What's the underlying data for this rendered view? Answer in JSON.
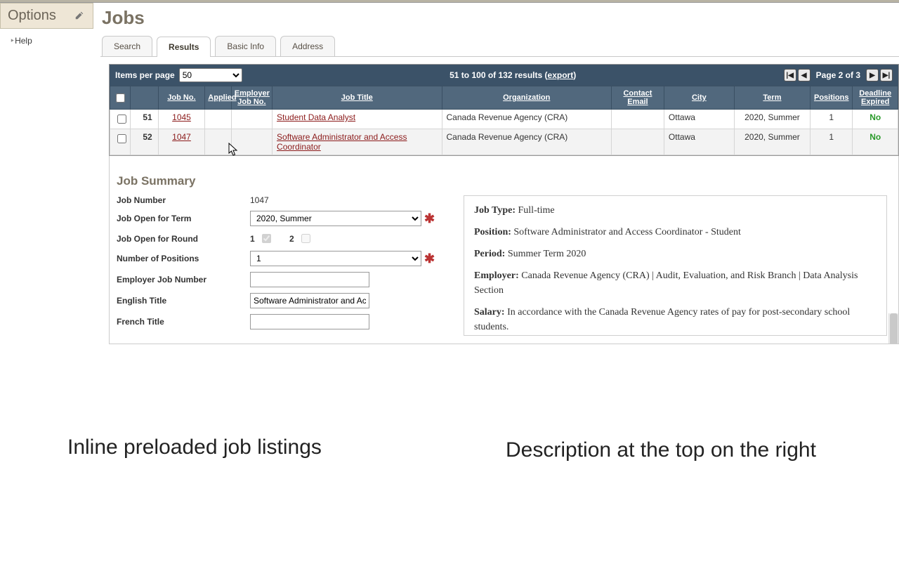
{
  "sidebar": {
    "title": "Options",
    "help": "Help"
  },
  "page": {
    "title": "Jobs"
  },
  "tabs": [
    "Search",
    "Results",
    "Basic Info",
    "Address"
  ],
  "activeTab": 1,
  "toolbar": {
    "itemsPerPageLabel": "Items per page",
    "itemsPerPageValue": "50",
    "resultsText": "51 to 100 of 132 results (",
    "exportLabel": "export",
    "resultsTextEnd": ")",
    "pageLabel": "Page 2 of 3",
    "first": "|◀",
    "prev": "◀",
    "next": "▶",
    "last": "▶|"
  },
  "columns": [
    "",
    "",
    "Job No.",
    "Applied",
    "Employer Job No.",
    "Job Title",
    "Organization",
    "Contact Email",
    "City",
    "Term",
    "Positions",
    "Deadline Expired"
  ],
  "rows": [
    {
      "rank": "51",
      "jobno": "1045",
      "applied": "",
      "empjob": "",
      "title": "Student Data Analyst",
      "org": "Canada Revenue Agency (CRA)",
      "email": "",
      "city": "Ottawa",
      "term": "2020, Summer",
      "positions": "1",
      "deadline": "No"
    },
    {
      "rank": "52",
      "jobno": "1047",
      "applied": "",
      "empjob": "",
      "title": "Software Administrator and Access Coordinator",
      "org": "Canada Revenue Agency (CRA)",
      "email": "",
      "city": "Ottawa",
      "term": "2020, Summer",
      "positions": "1",
      "deadline": "No"
    }
  ],
  "summary": {
    "heading": "Job Summary",
    "labels": {
      "jobNumber": "Job Number",
      "openTerm": "Job Open for Term",
      "openRound": "Job Open for Round",
      "numPositions": "Number of Positions",
      "empJobNo": "Employer Job Number",
      "engTitle": "English Title",
      "frTitle": "French Title"
    },
    "values": {
      "jobNumber": "1047",
      "termValue": "2020, Summer",
      "round1": "1",
      "round2": "2",
      "positionsValue": "1",
      "empJobNoValue": "",
      "engTitleValue": "Software Administrator and Access Coordinator",
      "frTitleValue": ""
    },
    "desc": {
      "jobTypeLabel": "Job Type:",
      "jobType": " Full-time",
      "positionLabel": "Position:",
      "position": " Software Administrator and Access Coordinator - Student",
      "periodLabel": "Period:",
      "period": " Summer Term 2020",
      "employerLabel": "Employer:",
      "employer": " Canada Revenue Agency (CRA) | Audit, Evaluation, and Risk Branch | Data Analysis Section",
      "salaryLabel": "Salary:",
      "salary": " In accordance with the Canada Revenue Agency rates of pay for post-secondary school students."
    }
  },
  "annotations": {
    "left": "Inline preloaded job listings",
    "right": "Description at the top on the right"
  }
}
